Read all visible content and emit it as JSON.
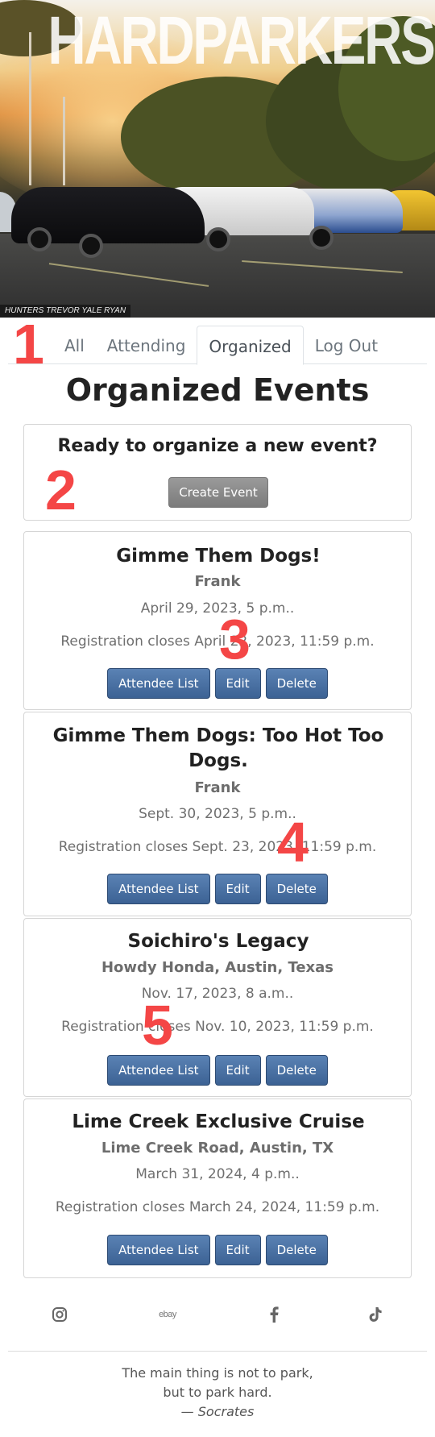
{
  "hero": {
    "title": "HARDPARKERS",
    "photo_credit": "HUNTERS TREVOR YALE RYAN"
  },
  "nav": {
    "tabs": [
      {
        "label": "All",
        "active": false
      },
      {
        "label": "Attending",
        "active": false
      },
      {
        "label": "Organized",
        "active": true
      },
      {
        "label": "Log Out",
        "active": false
      }
    ]
  },
  "annotations": [
    "1",
    "2",
    "3",
    "4",
    "5"
  ],
  "page_title": "Organized Events",
  "create": {
    "prompt": "Ready to organize a new event?",
    "button_label": "Create Event"
  },
  "events": [
    {
      "title": "Gimme Them Dogs!",
      "organizer": "Frank",
      "date": "April 29, 2023, 5 p.m..",
      "registration": "Registration closes April 22, 2023, 11:59 p.m.",
      "buttons": [
        "Attendee List",
        "Edit",
        "Delete"
      ]
    },
    {
      "title": "Gimme Them Dogs: Too Hot Too Dogs.",
      "organizer": "Frank",
      "date": "Sept. 30, 2023, 5 p.m..",
      "registration": "Registration closes Sept. 23, 2023, 11:59 p.m.",
      "buttons": [
        "Attendee List",
        "Edit",
        "Delete"
      ]
    },
    {
      "title": "Soichiro's Legacy",
      "organizer": "Howdy Honda, Austin, Texas",
      "date": "Nov. 17, 2023, 8 a.m..",
      "registration": "Registration closes Nov. 10, 2023, 11:59 p.m.",
      "buttons": [
        "Attendee List",
        "Edit",
        "Delete"
      ]
    },
    {
      "title": "Lime Creek Exclusive Cruise",
      "organizer": "Lime Creek Road, Austin, TX",
      "date": "March 31, 2024, 4 p.m..",
      "registration": "Registration closes March 24, 2024, 11:59 p.m.",
      "buttons": [
        "Attendee List",
        "Edit",
        "Delete"
      ]
    }
  ],
  "footer": {
    "social": [
      "instagram-icon",
      "ebay-icon",
      "facebook-icon",
      "tiktok-icon"
    ],
    "ebay_text": "ebay",
    "quote_line1": "The main thing is not to park,",
    "quote_line2": "but to park hard.",
    "quote_author": "— Socrates"
  },
  "colors": {
    "primary_button": "#4a72a6",
    "secondary_button": "#8a8a8a",
    "annotation": "#f44646"
  }
}
